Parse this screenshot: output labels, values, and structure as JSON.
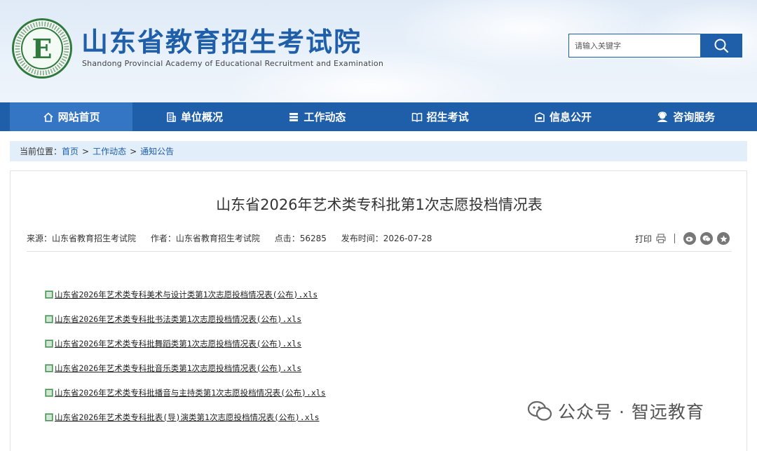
{
  "header": {
    "title": "山东省教育招生考试院",
    "subtitle": "Shandong Provincial Academy of Educational Recruitment and Examination",
    "logo_letter": "E",
    "search_placeholder": "请输入关键字"
  },
  "nav": {
    "items": [
      {
        "label": "网站首页",
        "icon": "home-icon",
        "active": true
      },
      {
        "label": "单位概况",
        "icon": "building-icon",
        "active": false
      },
      {
        "label": "工作动态",
        "icon": "list-icon",
        "active": false
      },
      {
        "label": "招生考试",
        "icon": "book-icon",
        "active": false
      },
      {
        "label": "信息公开",
        "icon": "info-box-icon",
        "active": false
      },
      {
        "label": "咨询服务",
        "icon": "support-icon",
        "active": false
      }
    ]
  },
  "breadcrumb": {
    "label": "当前位置：",
    "items": [
      "首页",
      "工作动态",
      "通知公告"
    ],
    "separator": ">"
  },
  "article": {
    "title": "山东省2026年艺术类专科批第1次志愿投档情况表",
    "source": "来源：山东省教育招生考试院",
    "author": "作者：山东省教育招生考试院",
    "hits": "点击：56285",
    "date": "发布时间：2026-07-28",
    "print_label": "打印"
  },
  "attachments": [
    "山东省2026年艺术类专科美术与设计类第1次志愿投档情况表(公布).xls",
    "山东省2026年艺术类专科批书法类第1次志愿投档情况表(公布).xls",
    "山东省2026年艺术类专科批舞蹈类第1次志愿投档情况表(公布).xls",
    "山东省2026年艺术类专科批音乐类第1次志愿投档情况表(公布).xls",
    "山东省2026年艺术类专科批播音与主持类第1次志愿投档情况表(公布).xls",
    "山东省2026年艺术类专科批表(导)演类第1次志愿投档情况表(公布).xls"
  ],
  "watermark": "公众号 · 智远教育",
  "colors": {
    "brand_blue": "#1f5ea8",
    "nav_active": "#3475c4",
    "breadcrumb_bg": "#e2eef9",
    "logo_green": "#2f7a3d"
  }
}
